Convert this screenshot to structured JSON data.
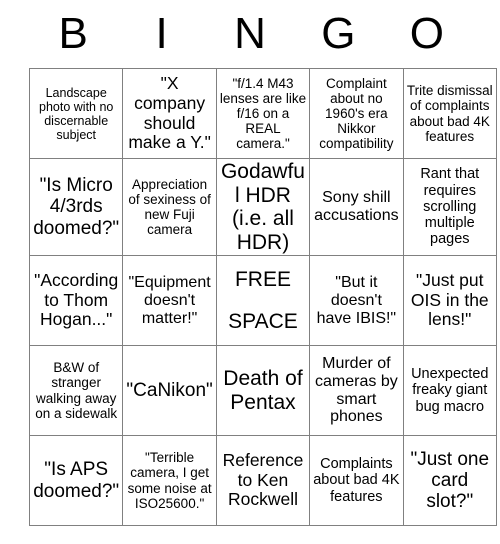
{
  "header": {
    "letters": [
      "B",
      "I",
      "N",
      "G",
      "O"
    ]
  },
  "colors": {
    "border": "#808080",
    "text": "#000000",
    "background": "#ffffff"
  },
  "grid": {
    "rows": [
      [
        {
          "text": "Landscape photo with no discernable subject",
          "size": "fs-10"
        },
        {
          "text": "\"X company should make a Y.\"",
          "size": "fs-14"
        },
        {
          "text": "\"f/1.4 M43 lenses are like f/16 on a REAL camera.\"",
          "size": "fs-11"
        },
        {
          "text": "Complaint about no 1960's era Nikkor compatibility",
          "size": "fs-11"
        },
        {
          "text": "Trite dismissal of complaints about bad 4K features",
          "size": "fs-11"
        }
      ],
      [
        {
          "text": "\"Is Micro 4/3rds doomed?\"",
          "size": "fs-15"
        },
        {
          "text": "Appreciation of sexiness of new Fuji camera",
          "size": "fs-11"
        },
        {
          "text": "Godawful HDR (i.e. all HDR)",
          "size": "fs-16"
        },
        {
          "text": "Sony shill accusations",
          "size": "fs-13"
        },
        {
          "text": "Rant that requires scrolling multiple pages",
          "size": "fs-12"
        }
      ],
      [
        {
          "text": "\"According to Thom Hogan...\"",
          "size": "fs-14"
        },
        {
          "text": "\"Equipment doesn't matter!\"",
          "size": "fs-13"
        },
        {
          "text": "FREE SPACE",
          "size": "fs-free",
          "free_space": true,
          "line1": "FREE",
          "line2": "SPACE"
        },
        {
          "text": "\"But it doesn't have IBIS!\"",
          "size": "fs-13"
        },
        {
          "text": "\"Just put OIS in the lens!\"",
          "size": "fs-14"
        }
      ],
      [
        {
          "text": "B&W of stranger walking away on a sidewalk",
          "size": "fs-11"
        },
        {
          "text": "\"CaNikon\"",
          "size": "fs-15"
        },
        {
          "text": "Death of Pentax",
          "size": "fs-16"
        },
        {
          "text": "Murder of cameras by smart phones",
          "size": "fs-13"
        },
        {
          "text": "Unexpected freaky giant bug macro",
          "size": "fs-12"
        }
      ],
      [
        {
          "text": "\"Is APS doomed?\"",
          "size": "fs-15"
        },
        {
          "text": "\"Terrible camera, I get some noise at ISO25600.\"",
          "size": "fs-11"
        },
        {
          "text": "Reference to Ken Rockwell",
          "size": "fs-14"
        },
        {
          "text": "Complaints about bad 4K features",
          "size": "fs-12"
        },
        {
          "text": "\"Just one card slot?\"",
          "size": "fs-15"
        }
      ]
    ]
  }
}
